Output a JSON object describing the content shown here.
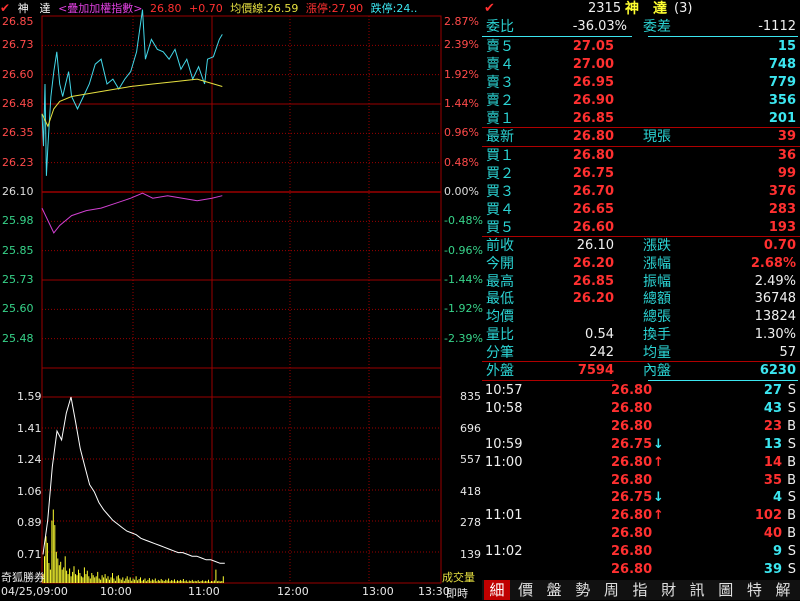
{
  "header": {
    "name": "神　達",
    "overlay": "<疊加加權指數>",
    "price": "26.80",
    "change": "+0.70",
    "avg_line": "均價線:26.59",
    "limit_up": "漲停:27.90",
    "limit_down": "跌停:24.."
  },
  "price_axis": [
    "26.85",
    "26.73",
    "26.60",
    "26.48",
    "26.35",
    "26.23",
    "26.10",
    "25.98",
    "25.85",
    "25.73",
    "25.60",
    "25.48"
  ],
  "pct_axis": [
    "2.87%",
    "2.39%",
    "1.92%",
    "1.44%",
    "0.96%",
    "0.48%",
    "0.00%",
    "-0.48%",
    "-0.96%",
    "-1.44%",
    "-1.92%",
    "-2.39%"
  ],
  "vol_axis_left": [
    "1.59",
    "1.41",
    "1.24",
    "1.06",
    "0.89",
    "0.71"
  ],
  "vol_axis_right": [
    "835",
    "696",
    "557",
    "418",
    "278",
    "139"
  ],
  "bottom": {
    "logo": "奇狐勝券",
    "volume_label": "成交量",
    "instant": "即時",
    "times": [
      "04/25,09:00",
      "10:00",
      "11:00",
      "12:00",
      "13:00",
      "13:30"
    ]
  },
  "chart_data": {
    "type": "line",
    "x_range": [
      "09:00",
      "13:30"
    ],
    "ylim": [
      25.48,
      26.85
    ],
    "pct_lim": [
      "-2.39%",
      "2.87%"
    ],
    "series": [
      {
        "name": "",
        "color": "#43d7e8",
        "x": [
          "09:00",
          "09:01",
          "09:02",
          "09:03",
          "09:04",
          "09:06",
          "09:08",
          "09:10",
          "09:12",
          "09:14",
          "09:16",
          "09:18",
          "09:20",
          "09:24",
          "09:28",
          "09:32",
          "09:36",
          "09:40",
          "09:44",
          "09:48",
          "09:52",
          "09:56",
          "10:00",
          "10:04",
          "10:08",
          "10:10",
          "10:14",
          "10:18",
          "10:22",
          "10:26",
          "10:30",
          "10:34",
          "10:38",
          "10:42",
          "10:46",
          "10:50",
          "10:52",
          "10:56",
          "11:00",
          "11:02"
        ],
        "values": [
          26.48,
          26.35,
          26.6,
          26.23,
          26.35,
          26.55,
          26.65,
          26.73,
          26.6,
          26.55,
          26.6,
          26.65,
          26.55,
          26.5,
          26.55,
          26.6,
          26.68,
          26.7,
          26.6,
          26.62,
          26.58,
          26.62,
          26.65,
          26.73,
          26.9,
          26.7,
          26.78,
          26.74,
          26.73,
          26.7,
          26.74,
          26.66,
          26.7,
          26.62,
          26.67,
          26.6,
          26.7,
          26.71,
          26.78,
          26.8
        ]
      },
      {
        "name": "",
        "color": "#e6e040",
        "x": [
          "09:00",
          "09:04",
          "09:08",
          "09:12",
          "09:20",
          "09:30",
          "09:40",
          "09:50",
          "10:00",
          "10:15",
          "10:30",
          "10:45",
          "11:02"
        ],
        "values": [
          26.48,
          26.43,
          26.5,
          26.53,
          26.55,
          26.56,
          26.57,
          26.58,
          26.59,
          26.6,
          26.61,
          26.62,
          26.59
        ]
      },
      {
        "name": "",
        "color": "#d040d0",
        "x": [
          "09:00",
          "09:04",
          "09:08",
          "09:12",
          "09:20",
          "09:30",
          "09:40",
          "09:50",
          "10:00",
          "10:08",
          "10:15",
          "10:25",
          "10:35",
          "10:45",
          "10:55",
          "11:02"
        ],
        "values": [
          26.1,
          26.05,
          26.0,
          26.03,
          26.07,
          26.09,
          26.1,
          26.12,
          26.14,
          26.16,
          26.14,
          26.15,
          26.14,
          26.13,
          26.14,
          26.15
        ]
      }
    ],
    "volume": {
      "x_count": 123,
      "values": [
        40,
        120,
        210,
        180,
        90,
        60,
        280,
        330,
        260,
        140,
        110,
        80,
        95,
        60,
        70,
        120,
        55,
        40,
        65,
        30,
        50,
        75,
        40,
        35,
        60,
        45,
        30,
        25,
        70,
        40,
        55,
        30,
        20,
        45,
        35,
        25,
        30,
        50,
        20,
        15,
        35,
        25,
        40,
        20,
        30,
        15,
        25,
        45,
        20,
        10,
        30,
        35,
        20,
        15,
        25,
        10,
        20,
        30,
        15,
        25,
        10,
        20,
        15,
        30,
        12,
        18,
        25,
        10,
        15,
        20,
        8,
        14,
        22,
        10,
        16,
        12,
        20,
        8,
        14,
        10,
        18,
        12,
        9,
        15,
        11,
        20,
        8,
        13,
        10,
        16,
        7,
        12,
        9,
        14,
        10,
        18,
        8,
        12,
        6,
        11,
        9,
        14,
        7,
        10,
        8,
        13,
        6,
        9,
        12,
        7,
        10,
        8,
        15,
        6,
        9,
        7,
        11,
        60,
        8,
        10,
        7,
        9,
        30
      ],
      "avg_line": [
        0.71,
        0.9,
        1.2,
        1.4,
        1.35,
        1.5,
        1.59,
        1.45,
        1.3,
        1.2,
        1.1,
        1.06,
        1.0,
        0.96,
        0.93,
        0.9,
        0.88,
        0.86,
        0.84,
        0.83,
        0.82,
        0.8,
        0.79,
        0.78,
        0.77,
        0.76,
        0.75,
        0.74,
        0.73,
        0.72,
        0.72,
        0.71,
        0.7,
        0.7,
        0.69,
        0.68,
        0.68,
        0.67,
        0.66,
        0.66
      ],
      "ylim": [
        0,
        835
      ]
    }
  },
  "quote": {
    "code": "2315",
    "name": "神　達",
    "suffix": "(3)",
    "weibi_label": "委比",
    "weibi": "-36.03%",
    "weicha_label": "委差",
    "weicha": "-1112",
    "asks": [
      {
        "label": "賣５",
        "price": "27.05",
        "vol": "15"
      },
      {
        "label": "賣４",
        "price": "27.00",
        "vol": "748"
      },
      {
        "label": "賣３",
        "price": "26.95",
        "vol": "779"
      },
      {
        "label": "賣２",
        "price": "26.90",
        "vol": "356"
      },
      {
        "label": "賣１",
        "price": "26.85",
        "vol": "201"
      }
    ],
    "last_label": "最新",
    "last": "26.80",
    "curvol_label": "現張",
    "curvol": "39",
    "bids": [
      {
        "label": "買１",
        "price": "26.80",
        "vol": "36"
      },
      {
        "label": "買２",
        "price": "26.75",
        "vol": "99"
      },
      {
        "label": "買３",
        "price": "26.70",
        "vol": "376"
      },
      {
        "label": "買４",
        "price": "26.65",
        "vol": "283"
      },
      {
        "label": "買５",
        "price": "26.60",
        "vol": "193"
      }
    ],
    "stats": [
      {
        "l": "前收",
        "v": "26.10",
        "vc": "white",
        "l2": "漲跌",
        "v2": "0.70",
        "v2c": "red"
      },
      {
        "l": "今開",
        "v": "26.20",
        "vc": "red",
        "l2": "漲幅",
        "v2": "2.68%",
        "v2c": "red"
      },
      {
        "l": "最高",
        "v": "26.85",
        "vc": "red",
        "l2": "振幅",
        "v2": "2.49%",
        "v2c": "white"
      },
      {
        "l": "最低",
        "v": "26.20",
        "vc": "red",
        "l2": "總額",
        "v2": "36748",
        "v2c": "white"
      },
      {
        "l": "均價",
        "v": "",
        "vc": "white",
        "l2": "總張",
        "v2": "13824",
        "v2c": "white"
      },
      {
        "l": "量比",
        "v": "0.54",
        "vc": "white",
        "l2": "換手",
        "v2": "1.30%",
        "v2c": "white"
      },
      {
        "l": "分筆",
        "v": "242",
        "vc": "white",
        "l2": "均量",
        "v2": "57",
        "v2c": "white"
      }
    ],
    "outer_label": "外盤",
    "outer": "7594",
    "inner_label": "內盤",
    "inner": "6230",
    "ticks": [
      {
        "t": "10:57",
        "p": "26.80",
        "pc": "red",
        "arr": "",
        "v": "27",
        "vc": "cyan",
        "s": "S"
      },
      {
        "t": "10:58",
        "p": "26.80",
        "pc": "red",
        "arr": "",
        "v": "43",
        "vc": "cyan",
        "s": "S"
      },
      {
        "t": "",
        "p": "26.80",
        "pc": "red",
        "arr": "",
        "v": "23",
        "vc": "red",
        "s": "B"
      },
      {
        "t": "10:59",
        "p": "26.75",
        "pc": "red",
        "arr": "↓",
        "v": "13",
        "vc": "cyan",
        "s": "S"
      },
      {
        "t": "11:00",
        "p": "26.80",
        "pc": "red",
        "arr": "↑",
        "v": "14",
        "vc": "red",
        "s": "B"
      },
      {
        "t": "",
        "p": "26.80",
        "pc": "red",
        "arr": "",
        "v": "35",
        "vc": "red",
        "s": "B"
      },
      {
        "t": "",
        "p": "26.75",
        "pc": "red",
        "arr": "↓",
        "v": "4",
        "vc": "cyan",
        "s": "S"
      },
      {
        "t": "11:01",
        "p": "26.80",
        "pc": "red",
        "arr": "↑",
        "v": "102",
        "vc": "red",
        "s": "B"
      },
      {
        "t": "",
        "p": "26.80",
        "pc": "red",
        "arr": "",
        "v": "40",
        "vc": "red",
        "s": "B"
      },
      {
        "t": "11:02",
        "p": "26.80",
        "pc": "red",
        "arr": "",
        "v": "9",
        "vc": "cyan",
        "s": "S"
      },
      {
        "t": "",
        "p": "26.80",
        "pc": "red",
        "arr": "",
        "v": "39",
        "vc": "cyan",
        "s": "S"
      }
    ]
  },
  "tabs": [
    "細",
    "價",
    "盤",
    "勢",
    "周",
    "指",
    "財",
    "訊",
    "圖",
    "特",
    "解"
  ],
  "colors": {
    "up": "#ff3030",
    "down": "#3ce6f0",
    "grid": "#9a0000",
    "label": "#2bd3d3"
  }
}
